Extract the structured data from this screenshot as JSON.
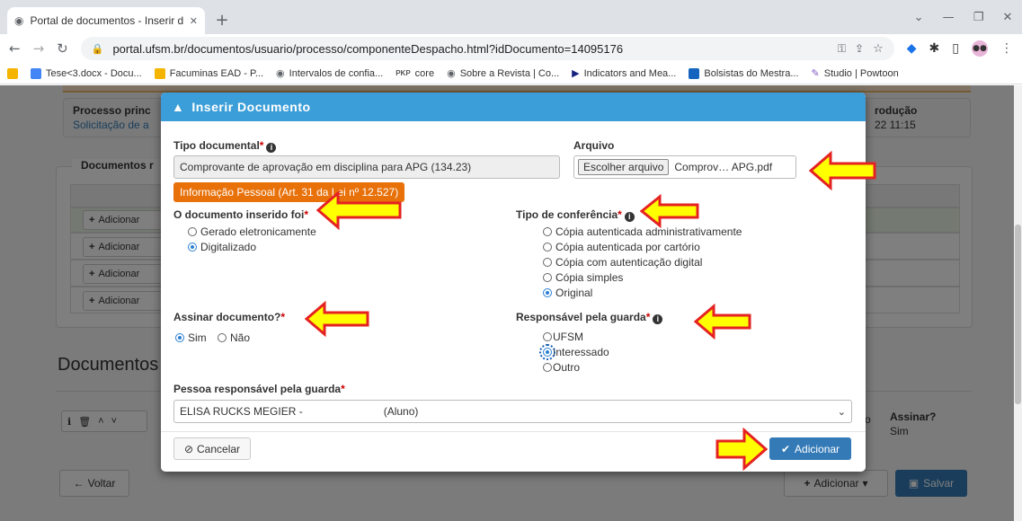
{
  "browser": {
    "tab_title": "Portal de documentos - Inserir d",
    "new_tab": "+",
    "url": "portal.ufsm.br/documentos/usuario/processo/componenteDespacho.html?idDocumento=14095176",
    "bookmarks": [
      {
        "label": "Tese<3.docx - Docu...",
        "color": "#4285f4"
      },
      {
        "label": "Facuminas EAD - P...",
        "color": "#f4b400"
      },
      {
        "label": "Intervalos de confia...",
        "color": "#5f6368"
      },
      {
        "label": "core",
        "color": "#555555",
        "prefix": "PKP"
      },
      {
        "label": "Sobre a Revista | Co...",
        "color": "#5f6368"
      },
      {
        "label": "Indicators and Mea...",
        "color": "#1a237e"
      },
      {
        "label": "Bolsistas do Mestra...",
        "color": "#1565c0"
      },
      {
        "label": "Studio | Powtoon",
        "color": "#7e57c2"
      }
    ]
  },
  "background": {
    "processo_label": "Processo princ",
    "processo_link": "Solicitação de a",
    "producao_label": "rodução",
    "producao_value": "22 11:15",
    "documentos_tab": "Documentos r",
    "adicionar": "Adicionar",
    "documentos_heading": "Documentos",
    "assinar_label": "Assinar?",
    "assinar_value": "Sim",
    "o_char": "o",
    "voltar": "Voltar",
    "adicionar_bottom": "Adicionar",
    "salvar": "Salvar"
  },
  "modal": {
    "title": "Inserir Documento",
    "tipo_documental_label": "Tipo documental",
    "tipo_documental_value": "Comprovante de aprovação em disciplina para APG (134.23)",
    "info_badge": "Informação Pessoal (Art. 31 da Lei nº 12.527)",
    "arquivo_label": "Arquivo",
    "escolher_arquivo": "Escolher arquivo",
    "arquivo_nome": "Comprov… APG.pdf",
    "documento_inserido_label": "O documento inserido foi",
    "documento_inserido_options": [
      {
        "label": "Gerado eletronicamente",
        "checked": false
      },
      {
        "label": "Digitalizado",
        "checked": true
      }
    ],
    "tipo_conferencia_label": "Tipo de conferência",
    "tipo_conferencia_options": [
      {
        "label": "Cópia autenticada administrativamente",
        "checked": false
      },
      {
        "label": "Cópia autenticada por cartório",
        "checked": false
      },
      {
        "label": "Cópia com autenticação digital",
        "checked": false
      },
      {
        "label": "Cópia simples",
        "checked": false
      },
      {
        "label": "Original",
        "checked": true
      }
    ],
    "assinar_label": "Assinar documento?",
    "assinar_sim": "Sim",
    "assinar_nao": "Não",
    "responsavel_label": "Responsável pela guarda",
    "responsavel_options": [
      {
        "label": "UFSM",
        "checked": false
      },
      {
        "label": "Interessado",
        "checked": true
      },
      {
        "label": "Outro",
        "checked": false
      }
    ],
    "pessoa_label": "Pessoa responsável pela guarda",
    "pessoa_name": "ELISA RUCKS MEGIER -",
    "pessoa_role": "(Aluno)",
    "cancelar": "Cancelar",
    "adicionar": "Adicionar"
  },
  "colors": {
    "header_blue": "#3c9ed8",
    "badge_orange": "#e8710a",
    "button_blue": "#337ab7",
    "arrow_fill": "#ffff00",
    "arrow_stroke": "#e52222"
  }
}
